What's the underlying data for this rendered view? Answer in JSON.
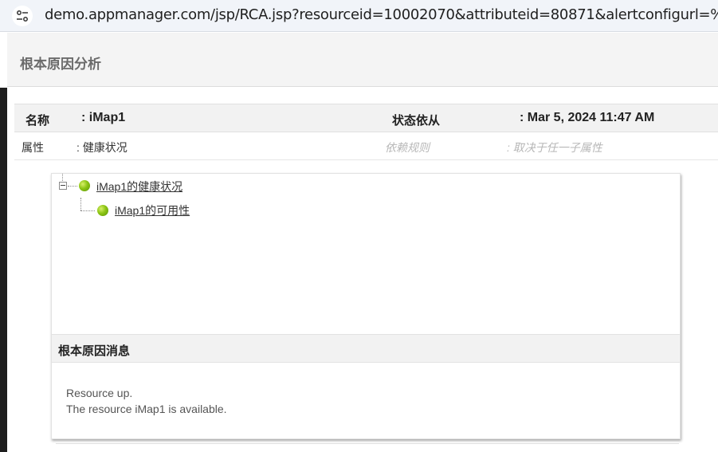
{
  "browser": {
    "url": "demo.appmanager.com/jsp/RCA.jsp?resourceid=10002070&attributeid=80871&alertconfigurl=%...",
    "site_icon": "tune-icon"
  },
  "page": {
    "title": "根本原因分析"
  },
  "info": {
    "name_label": "名称",
    "name_value": ": iMap1",
    "status_label": "状态依从",
    "status_value": ": Mar 5, 2024 11:47 AM",
    "attribute_label": "属性",
    "attribute_value": ": 健康状况",
    "rule_label": "依赖规则",
    "rule_value": ": 取决于任一子属性"
  },
  "tree": {
    "root": {
      "label": "iMap1的健康状况",
      "status": "green"
    },
    "child": {
      "label": "iMap1的可用性",
      "status": "green"
    }
  },
  "message": {
    "title": "根本原因消息",
    "line1": "Resource up.",
    "line2": "The resource iMap1 is available."
  },
  "colors": {
    "status_green": "#8cc414",
    "header_bg": "#f4f4f4"
  }
}
